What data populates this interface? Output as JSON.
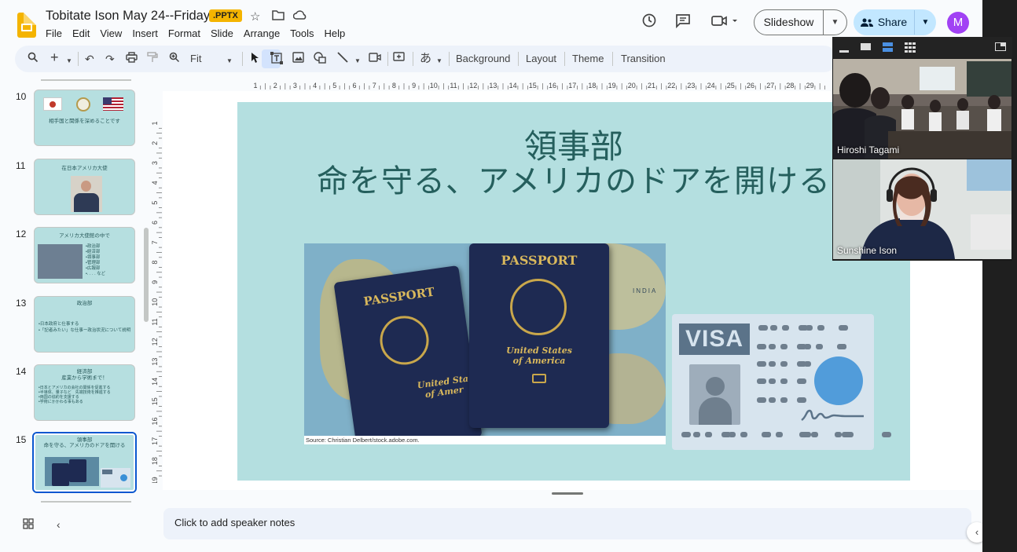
{
  "header": {
    "doc_title": "Tobitate Ison May 24--Friday",
    "file_badge": ".PPTX",
    "menus": [
      "File",
      "Edit",
      "View",
      "Insert",
      "Format",
      "Slide",
      "Arrange",
      "Tools",
      "Help"
    ],
    "slideshow_label": "Slideshow",
    "share_label": "Share",
    "avatar_letter": "M"
  },
  "toolbar": {
    "zoom_label": "Fit",
    "background_label": "Background",
    "layout_label": "Layout",
    "theme_label": "Theme",
    "transition_label": "Transition",
    "input_tool_glyph": "あ"
  },
  "filmstrip": [
    {
      "num": "10",
      "text": "相手国と関係を深めることです"
    },
    {
      "num": "11",
      "text": "在日本アメリカ大使"
    },
    {
      "num": "12",
      "text": "アメリカ大使館の中で",
      "bullets": [
        "•政治部",
        "•経済部",
        "•領事部",
        "•管理部",
        "•広報部",
        "•. . . . など"
      ]
    },
    {
      "num": "13",
      "text": "政治部",
      "bullets": [
        "•日本政府と仕事する",
        "•「記者みたい」な仕事ー政治状況について説明"
      ]
    },
    {
      "num": "14",
      "text": "経済部",
      "text2": "産業から学術まで！",
      "bullets": [
        "•日本とアメリカの会社の関係を促進する",
        "•半導体、量子など　先端技術を推進する",
        "•両国の協約を支援する",
        "•学術にかかわる事もある"
      ]
    },
    {
      "num": "15",
      "text": "領事部",
      "text2": "命を守る、アメリカのドアを開ける",
      "selected": true
    }
  ],
  "hruler_ticks": [
    "1",
    "2",
    "3",
    "4",
    "5",
    "6",
    "7",
    "8",
    "9",
    "10",
    "11",
    "12",
    "13",
    "14",
    "15",
    "16",
    "17",
    "18",
    "19",
    "20",
    "21",
    "22",
    "23",
    "24",
    "25",
    "26",
    "27",
    "28",
    "29"
  ],
  "vruler_ticks": [
    "1",
    "2",
    "3",
    "4",
    "5",
    "6",
    "7",
    "8",
    "9",
    "10",
    "11",
    "12",
    "13",
    "14",
    "15",
    "16",
    "17",
    "18",
    "19"
  ],
  "slide": {
    "title_line1": "領事部",
    "title_line2": "命を守る、アメリカのドアを開ける",
    "passport_label": "PASSPORT",
    "passport_country": "United States\nof America",
    "passport_country_partial": "United Sta\nof Amer",
    "map_label": "INDIA",
    "source": "Source: Christian Delbert/stock.adobe.com.",
    "visa_label": "VISA"
  },
  "notes_placeholder": "Click to add speaker notes",
  "video_call": {
    "participants": [
      {
        "name": "Hiroshi Tagami"
      },
      {
        "name": "Sunshine Ison"
      }
    ]
  },
  "colors": {
    "slide_bg": "#b4dfe0",
    "title": "#255f5d",
    "accent": "#0b57d0",
    "share_bg": "#c2e7ff",
    "avatar": "#a142f4",
    "badge": "#f4b400"
  }
}
